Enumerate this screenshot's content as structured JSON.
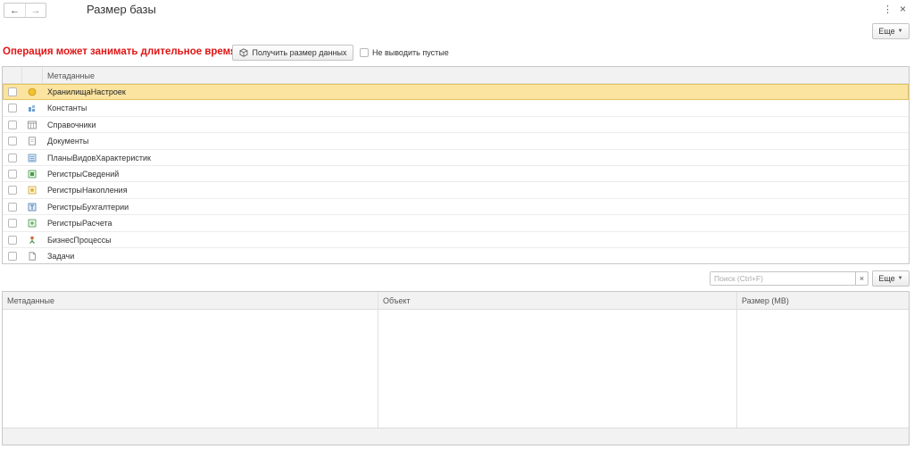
{
  "header": {
    "back_icon": "arrow-left-icon",
    "forward_icon": "arrow-right-icon",
    "title": "Размер базы",
    "menu_icon": "more-vertical-icon",
    "close_icon": "close-icon"
  },
  "toolbar": {
    "more_label": "Еще",
    "warning": "Операция может занимать длительное время!",
    "get_size_label": "Получить размер данных",
    "hide_empty_label": "Не выводить пустые",
    "hide_empty_checked": false
  },
  "tree": {
    "column_header": "Метаданные",
    "rows": [
      {
        "label": "ХранилищаНастроек",
        "icon": "settings-storage-icon",
        "selected": true,
        "checked": false
      },
      {
        "label": "Константы",
        "icon": "constants-icon",
        "selected": false,
        "checked": false
      },
      {
        "label": "Справочники",
        "icon": "catalogs-icon",
        "selected": false,
        "checked": false
      },
      {
        "label": "Документы",
        "icon": "documents-icon",
        "selected": false,
        "checked": false
      },
      {
        "label": "ПланыВидовХарактеристик",
        "icon": "characteristic-plans-icon",
        "selected": false,
        "checked": false
      },
      {
        "label": "РегистрыСведений",
        "icon": "information-registers-icon",
        "selected": false,
        "checked": false
      },
      {
        "label": "РегистрыНакопления",
        "icon": "accumulation-registers-icon",
        "selected": false,
        "checked": false
      },
      {
        "label": "РегистрыБухгалтерии",
        "icon": "accounting-registers-icon",
        "selected": false,
        "checked": false
      },
      {
        "label": "РегистрыРасчета",
        "icon": "calculation-registers-icon",
        "selected": false,
        "checked": false
      },
      {
        "label": "БизнесПроцессы",
        "icon": "business-processes-icon",
        "selected": false,
        "checked": false
      },
      {
        "label": "Задачи",
        "icon": "tasks-icon",
        "selected": false,
        "checked": false
      }
    ]
  },
  "search": {
    "placeholder": "Поиск (Ctrl+F)",
    "value": "",
    "more_label": "Еще"
  },
  "results": {
    "columns": [
      "Метаданные",
      "Объект",
      "Размер (MB)"
    ],
    "rows": []
  },
  "colors": {
    "warning": "#e01414",
    "selection": "#fbe4a0"
  }
}
